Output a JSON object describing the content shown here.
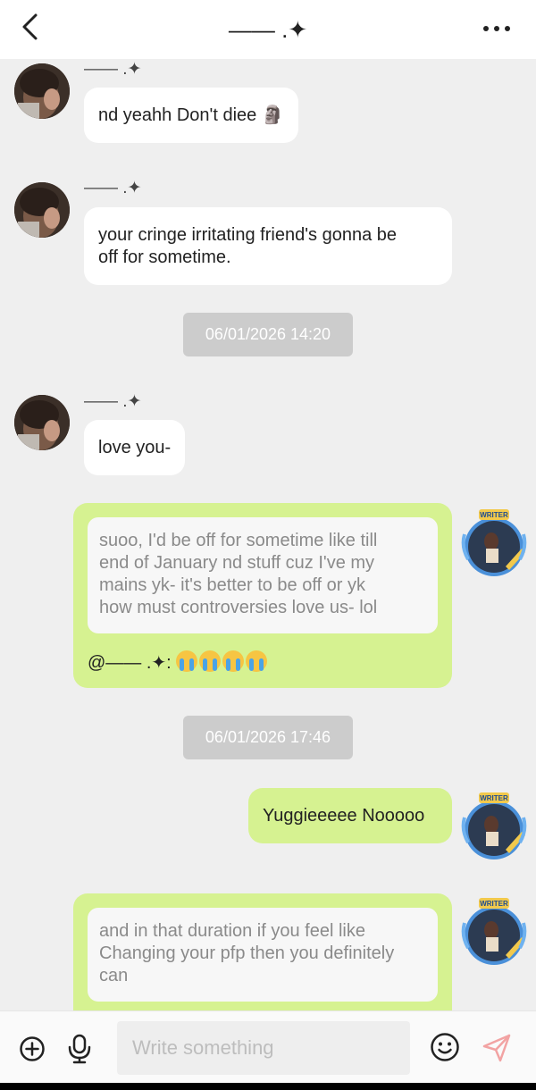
{
  "header": {
    "title": "—— .✦"
  },
  "messages": {
    "m1": {
      "sender": "—— .✦",
      "text": "nd yeahh Don't diee 🗿"
    },
    "m2": {
      "sender": "—— .✦",
      "line1": "your cringe irritating friend's gonna be",
      "line2": "off for sometime."
    },
    "time1": "06/01/2026 14:20",
    "m3": {
      "sender": "—— .✦",
      "text": "love you-"
    },
    "m4": {
      "quote_lines": [
        "suoo, I'd be off for sometime like till",
        "end of January nd stuff cuz I've my",
        "mains yk- it's better to be off or yk",
        "how must controversies love us- lol"
      ],
      "mention": "@—— .✦: "
    },
    "time2": "06/01/2026 17:46",
    "m5": {
      "text": "Yuggieeeee Nooooo"
    },
    "m6": {
      "quote_lines": [
        "and in that duration if you feel like",
        "Changing your pfp then you definitely",
        "can"
      ]
    },
    "avatar_badge": "WRITER"
  },
  "composer": {
    "placeholder": "Write something"
  },
  "colors": {
    "green_bubble": "#d6f291",
    "white_bubble": "#ffffff",
    "background": "#efefef",
    "time_pill": "#cccccc"
  }
}
